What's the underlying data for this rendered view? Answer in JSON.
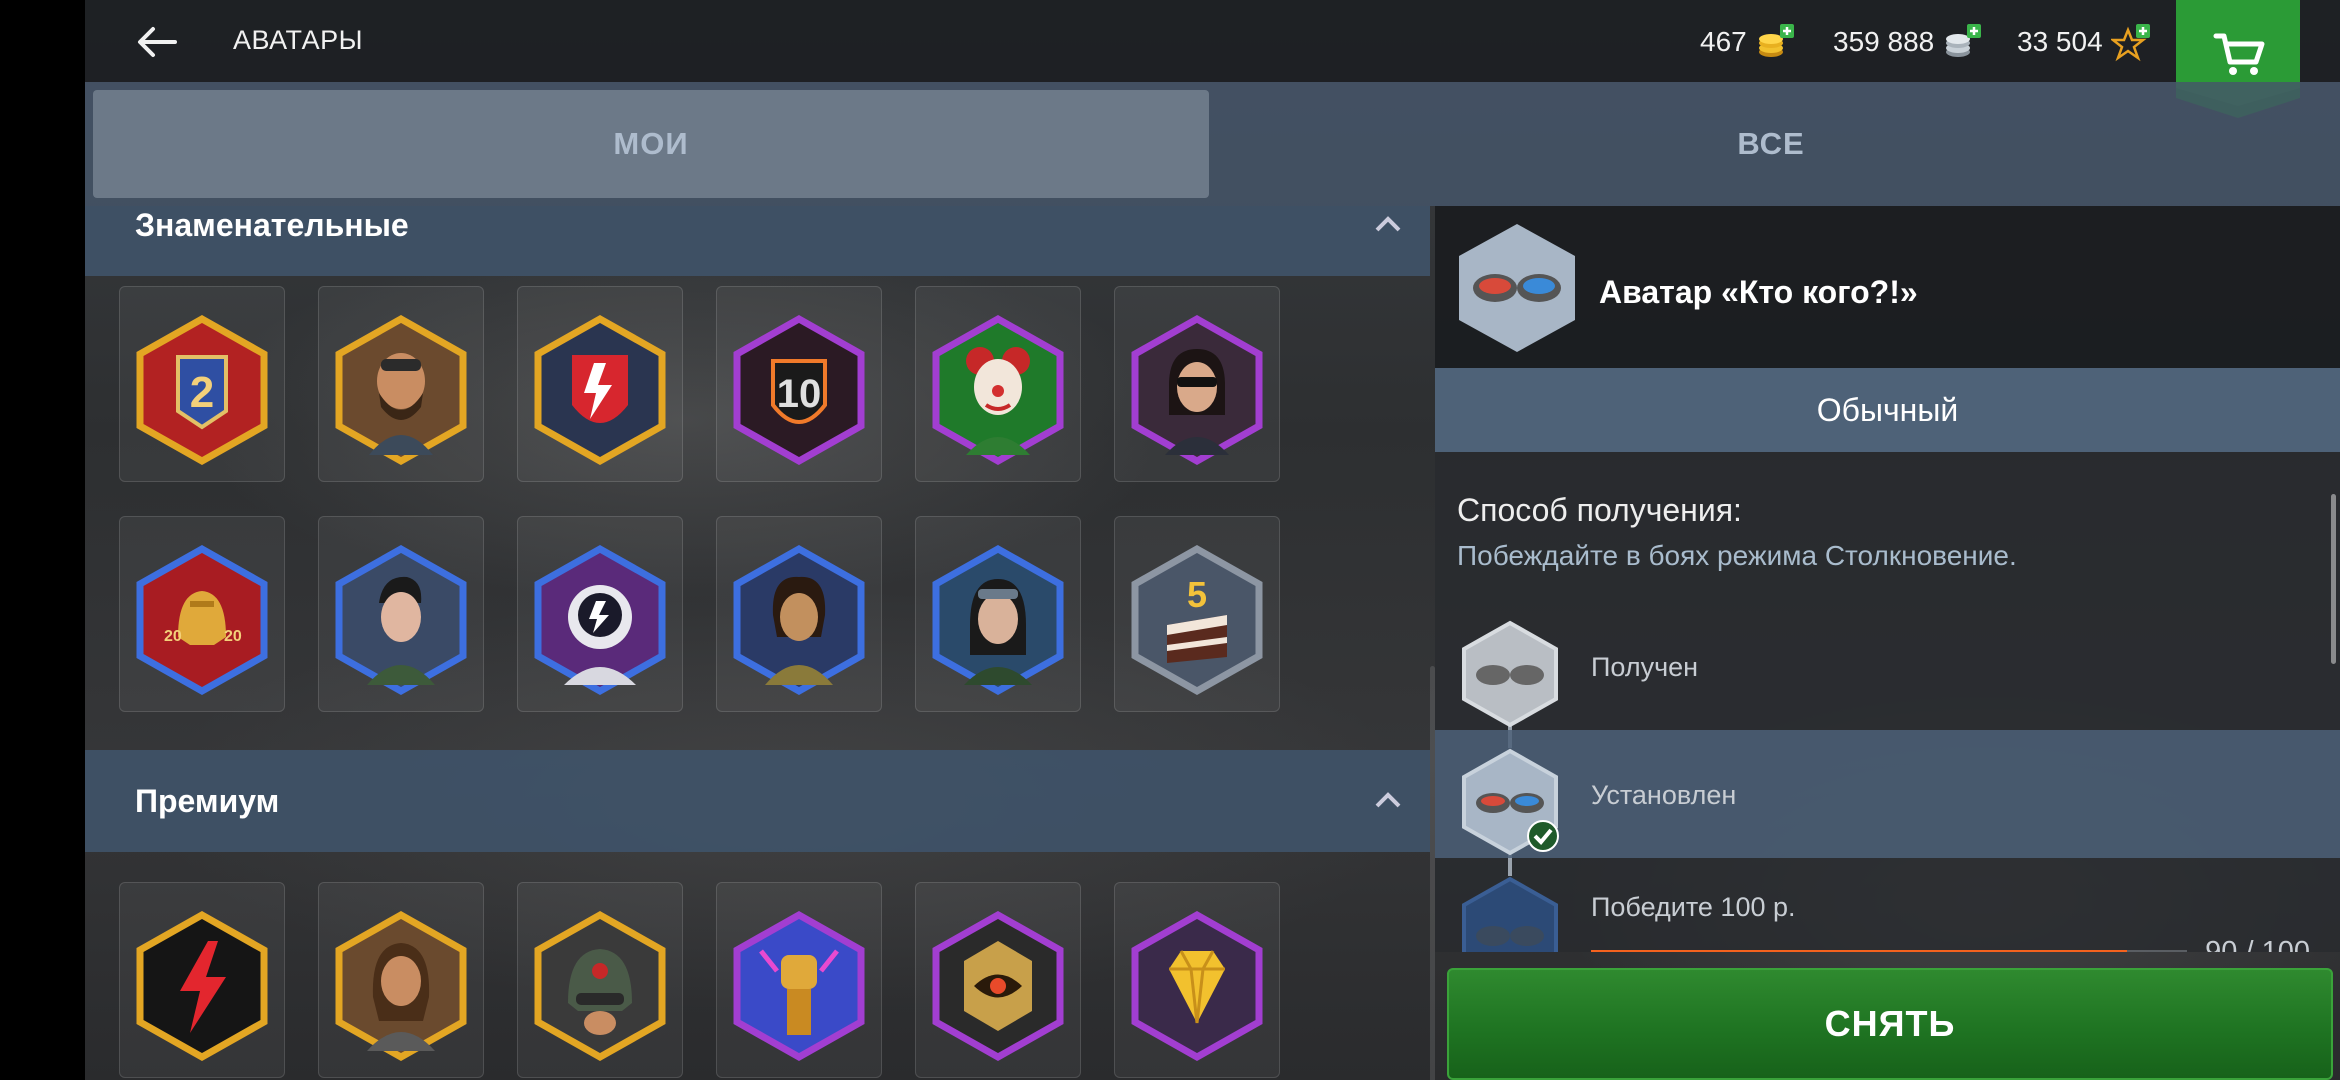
{
  "header": {
    "title": "АВАТАРЫ",
    "gold": "467",
    "credits": "359 888",
    "free_xp": "33 504"
  },
  "tabs": [
    {
      "label": "МОИ",
      "active": true
    },
    {
      "label": "ВСЕ",
      "active": false
    }
  ],
  "sections": {
    "notable": {
      "title": "Знаменательные"
    },
    "premium": {
      "title": "Премиум"
    }
  },
  "colors": {
    "frame_gold": "#e3a623",
    "frame_purple": "#a23ed1",
    "frame_blue": "#3d6fe0",
    "frame_grey": "#8d96a3",
    "accent_green": "#1f7422",
    "progress_orange": "#f5621e"
  },
  "detail": {
    "name": "Аватар «Кто кого?!»",
    "rarity": "Обычный",
    "method_label": "Способ получения:",
    "method_desc": "Побеждайте в боях режима Столкновение.",
    "steps": [
      {
        "label": "Получен"
      },
      {
        "label": "Установлен"
      },
      {
        "label": "Победите 100 р."
      }
    ],
    "progress": {
      "current": 90,
      "total": 100,
      "text": "90 / 100"
    },
    "button": "СНЯТЬ"
  }
}
